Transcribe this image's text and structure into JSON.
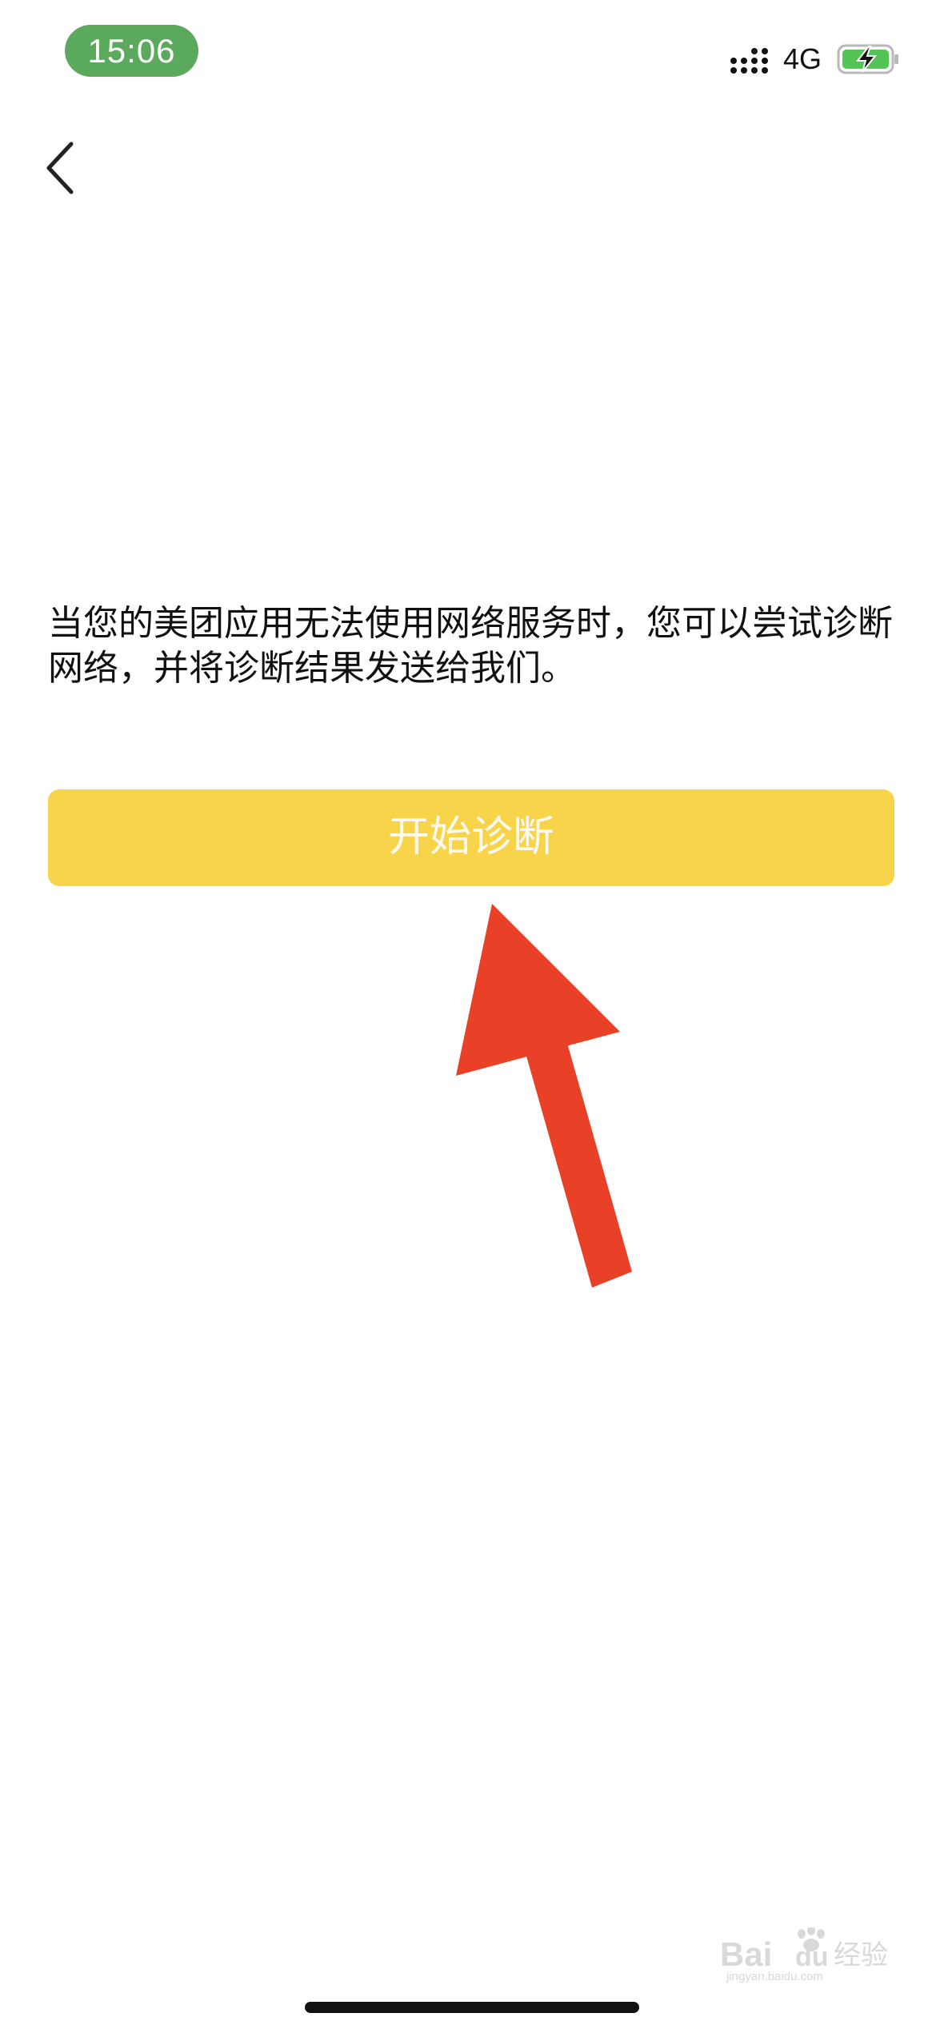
{
  "status_bar": {
    "time": "15:06",
    "network": "4G",
    "signal_icon": "signal-bars-icon",
    "battery_icon": "battery-charging-icon",
    "time_pill_color": "#5aa95c",
    "battery_color": "#55c457"
  },
  "nav": {
    "back_icon": "chevron-left-icon"
  },
  "main": {
    "description": "当您的美团应用无法使用网络服务时，您可以尝试诊断网络，并将诊断结果发送给我们。",
    "start_button_label": "开始诊断",
    "button_color": "#f7d44a"
  },
  "annotation": {
    "arrow_color": "#e94128"
  },
  "watermark": {
    "brand": "Bai",
    "brand_suffix": "du",
    "product": "经验",
    "url": "jingyan.baidu.com"
  }
}
